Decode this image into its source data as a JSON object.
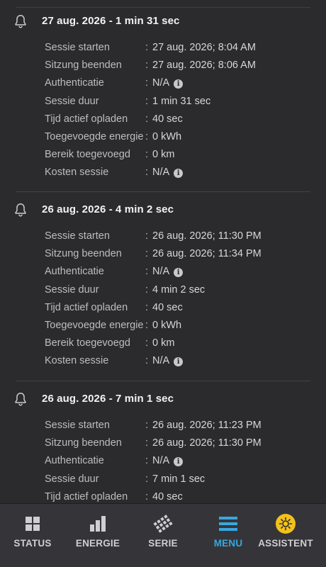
{
  "sessions": [
    {
      "title": "27 aug. 2026 - 1 min 31 sec",
      "rows": [
        {
          "label": "Sessie starten",
          "value": "27 aug. 2026; 8:04 AM",
          "info": false
        },
        {
          "label": "Sitzung beenden",
          "value": "27 aug. 2026; 8:06 AM",
          "info": false
        },
        {
          "label": "Authenticatie",
          "value": "N/A",
          "info": true
        },
        {
          "label": "Sessie duur",
          "value": "1 min 31 sec",
          "info": false
        },
        {
          "label": "Tijd actief opladen",
          "value": "40 sec",
          "info": false
        },
        {
          "label": "Toegevoegde energie",
          "value": "0 kWh",
          "info": false
        },
        {
          "label": "Bereik toegevoegd",
          "value": "0 km",
          "info": false
        },
        {
          "label": "Kosten sessie",
          "value": "N/A",
          "info": true
        }
      ]
    },
    {
      "title": "26 aug. 2026 - 4 min 2 sec",
      "rows": [
        {
          "label": "Sessie starten",
          "value": "26 aug. 2026; 11:30 PM",
          "info": false
        },
        {
          "label": "Sitzung beenden",
          "value": "26 aug. 2026; 11:34 PM",
          "info": false
        },
        {
          "label": "Authenticatie",
          "value": "N/A",
          "info": true
        },
        {
          "label": "Sessie duur",
          "value": "4 min 2 sec",
          "info": false
        },
        {
          "label": "Tijd actief opladen",
          "value": "40 sec",
          "info": false
        },
        {
          "label": "Toegevoegde energie",
          "value": "0 kWh",
          "info": false
        },
        {
          "label": "Bereik toegevoegd",
          "value": "0 km",
          "info": false
        },
        {
          "label": "Kosten sessie",
          "value": "N/A",
          "info": true
        }
      ]
    },
    {
      "title": "26 aug. 2026 - 7 min 1 sec",
      "rows": [
        {
          "label": "Sessie starten",
          "value": "26 aug. 2026; 11:23 PM",
          "info": false
        },
        {
          "label": "Sitzung beenden",
          "value": "26 aug. 2026; 11:30 PM",
          "info": false
        },
        {
          "label": "Authenticatie",
          "value": "N/A",
          "info": true
        },
        {
          "label": "Sessie duur",
          "value": "7 min 1 sec",
          "info": false
        },
        {
          "label": "Tijd actief opladen",
          "value": "40 sec",
          "info": false
        }
      ]
    }
  ],
  "separator": ":",
  "nav": [
    {
      "label": "STATUS",
      "icon": "status-grid-icon",
      "active": false
    },
    {
      "label": "ENERGIE",
      "icon": "energy-bars-icon",
      "active": false
    },
    {
      "label": "SERIE",
      "icon": "series-icon",
      "active": false
    },
    {
      "label": "MENU",
      "icon": "menu-icon",
      "active": true
    },
    {
      "label": "ASSISTENT",
      "icon": "assistant-sun-icon",
      "active": false
    }
  ],
  "colors": {
    "background": "#2b2b2e",
    "nav_background": "#353539",
    "active_accent": "#3aa6e0",
    "assistant_badge": "#f2c21b"
  }
}
